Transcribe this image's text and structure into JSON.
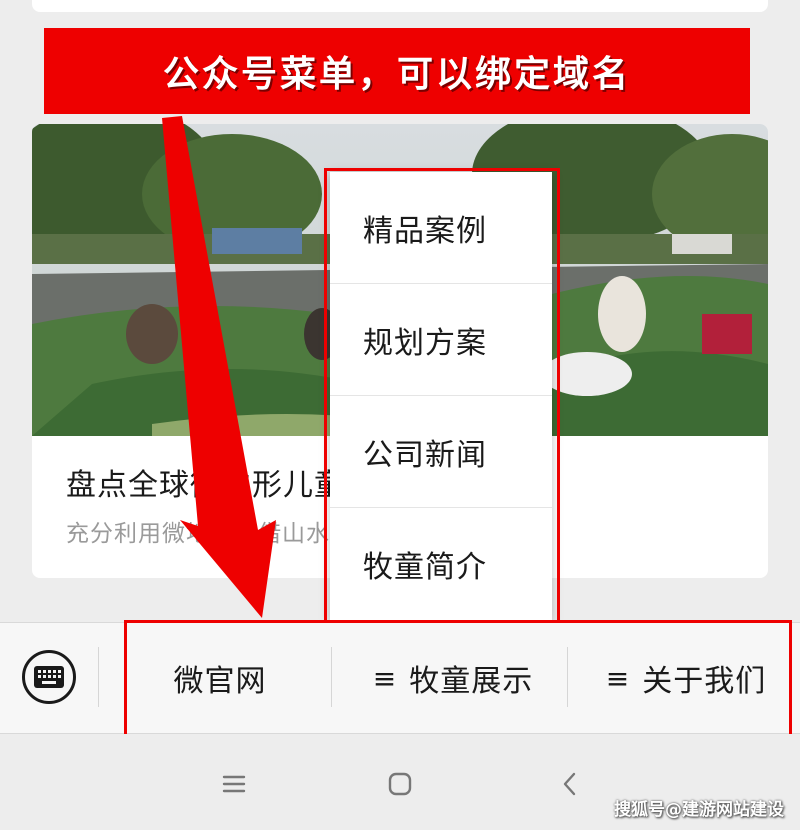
{
  "annotation": {
    "banner_text": "公众号菜单，可以绑定域名"
  },
  "article": {
    "title": "盘点全球微地形儿童公园设计案例",
    "description": "充分利用微地形，借山水造型带来大乐趣。"
  },
  "submenu": {
    "items": [
      {
        "label": "精品案例"
      },
      {
        "label": "规划方案"
      },
      {
        "label": "公司新闻"
      },
      {
        "label": "牧童简介"
      }
    ]
  },
  "menu_bar": {
    "tabs": [
      {
        "label": "微官网",
        "has_submenu": false
      },
      {
        "label": "牧童展示",
        "has_submenu": true
      },
      {
        "label": "关于我们",
        "has_submenu": true
      }
    ],
    "submenu_indicator": "≡"
  },
  "watermark": "搜狐号@建游网站建设",
  "colors": {
    "annotation_red": "#ee0000",
    "background": "#ededed"
  }
}
